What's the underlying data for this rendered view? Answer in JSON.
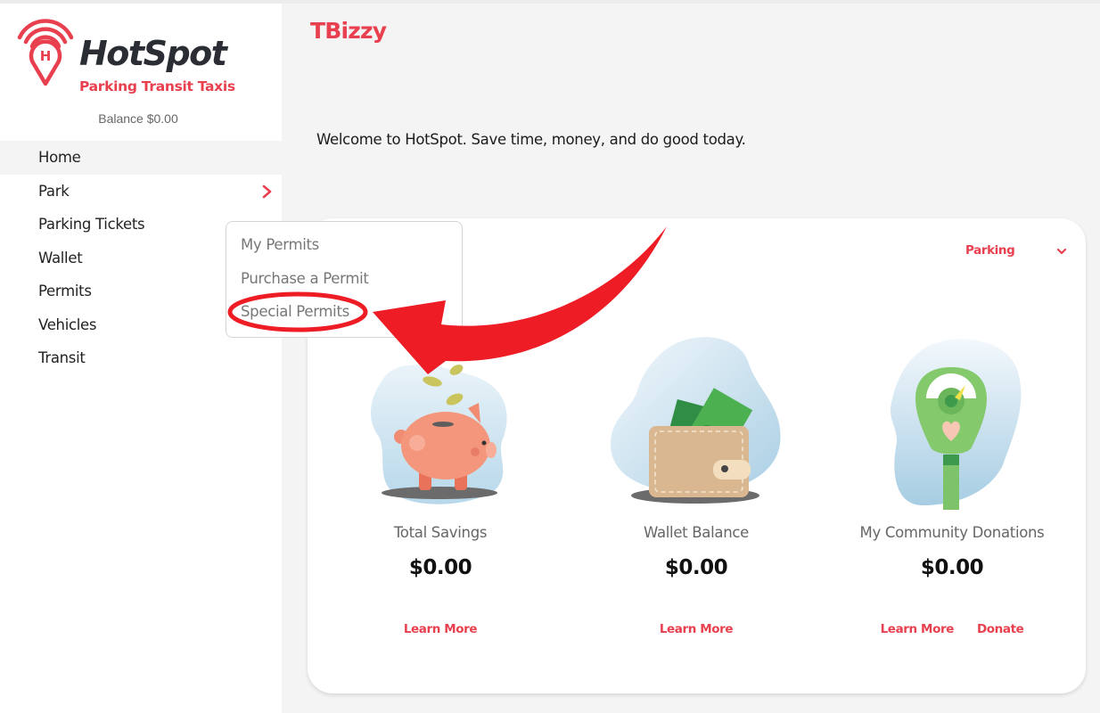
{
  "brand": {
    "name": "HotSpot",
    "tagline": "Parking Transit Taxis",
    "balance": "Balance $0.00",
    "accent_color": "#e8404f"
  },
  "sidebar": {
    "items": [
      {
        "label": "Home",
        "active": true
      },
      {
        "label": "Park",
        "has_submenu": true
      },
      {
        "label": "Parking Tickets"
      },
      {
        "label": "Wallet"
      },
      {
        "label": "Permits"
      },
      {
        "label": "Vehicles"
      },
      {
        "label": "Transit"
      }
    ]
  },
  "flyout": {
    "items": [
      {
        "label": "My Permits"
      },
      {
        "label": "Purchase a Permit"
      },
      {
        "label": "Special Permits",
        "highlighted": true
      }
    ]
  },
  "header": {
    "username": "TBizzy",
    "welcome": "Welcome to HotSpot. Save time, money, and do good today."
  },
  "card": {
    "filter": {
      "selected": "Parking",
      "icon": "chevron-down-icon"
    },
    "stats": [
      {
        "label": "Total Savings",
        "value": "$0.00",
        "illustration": "piggy-bank-icon",
        "links": [
          "Learn More"
        ]
      },
      {
        "label": "Wallet Balance",
        "value": "$0.00",
        "illustration": "wallet-icon",
        "links": [
          "Learn More"
        ]
      },
      {
        "label": "My Community Donations",
        "value": "$0.00",
        "illustration": "parking-meter-icon",
        "links": [
          "Learn More",
          "Donate"
        ]
      }
    ]
  },
  "annotation": {
    "color": "#ee1c25",
    "target": "Special Permits"
  }
}
